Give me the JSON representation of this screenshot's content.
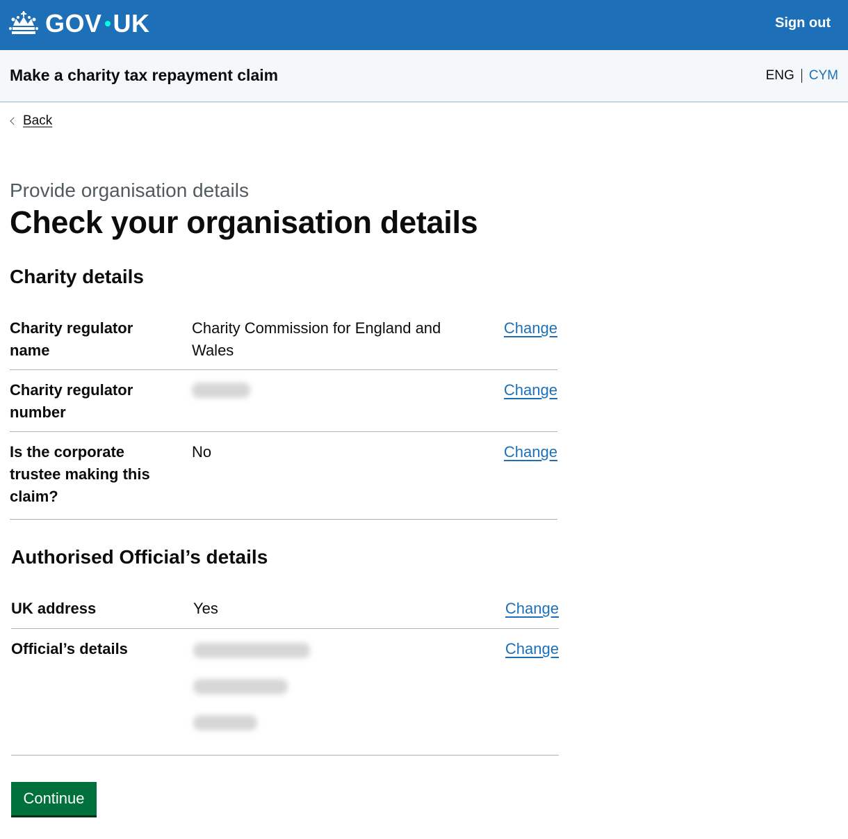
{
  "header": {
    "logo_text_left": "GOV",
    "logo_text_right": "UK",
    "sign_out": "Sign out"
  },
  "service": {
    "name": "Make a charity tax repayment claim",
    "lang_eng": "ENG",
    "lang_cym": "CYM"
  },
  "back_label": "Back",
  "caption": "Provide organisation details",
  "title": "Check your organisation details",
  "charity": {
    "heading": "Charity details",
    "rows": [
      {
        "key": "Charity regulator name",
        "value": "Charity Commission for England and Wales",
        "action": "Change"
      },
      {
        "key": "Charity regulator number",
        "value": "",
        "action": "Change"
      },
      {
        "key": "Is the corporate trustee making this claim?",
        "value": "No",
        "action": "Change"
      }
    ]
  },
  "official": {
    "heading": "Authorised Official’s details",
    "rows": [
      {
        "key": "UK address",
        "value": "Yes",
        "action": "Change"
      },
      {
        "key": "Official’s details",
        "value": "",
        "action": "Change"
      }
    ]
  },
  "continue_label": "Continue",
  "colors": {
    "header_blue": "#1d70b8",
    "button_green": "#00703c",
    "link_blue": "#1d70b8"
  }
}
